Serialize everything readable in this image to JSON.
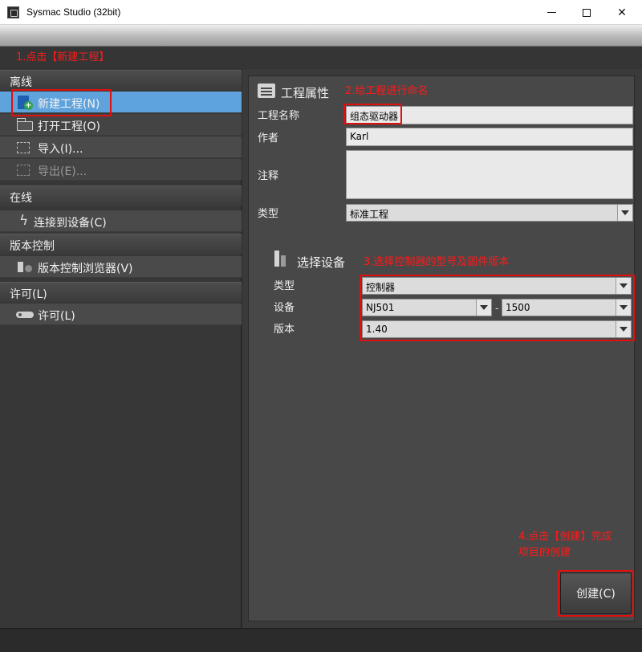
{
  "window": {
    "title": "Sysmac Studio (32bit)"
  },
  "annotations": {
    "step1": "1.点击【新建工程】",
    "step2": "2.给工程进行命名",
    "step3": "3.选择控制器的型号及固件版本",
    "step4_line1": "4.点击【创建】完成",
    "step4_line2": "项目的创建"
  },
  "sidebar": {
    "offline": {
      "header": "离线",
      "items": [
        {
          "label": "新建工程(N)",
          "icon": "new-project-icon"
        },
        {
          "label": "打开工程(O)",
          "icon": "folder-icon"
        },
        {
          "label": "导入(I)...",
          "icon": "import-icon"
        },
        {
          "label": "导出(E)...",
          "icon": "export-icon"
        }
      ]
    },
    "online": {
      "header": "在线",
      "items": [
        {
          "label": "连接到设备(C)",
          "icon": "lightning-icon"
        }
      ]
    },
    "version_control": {
      "header": "版本控制",
      "items": [
        {
          "label": "版本控制浏览器(V)",
          "icon": "version-control-icon"
        }
      ]
    },
    "license": {
      "header": "许可(L)",
      "items": [
        {
          "label": "许可(L)",
          "icon": "key-icon"
        }
      ]
    }
  },
  "project_properties": {
    "title": "工程属性",
    "name_label": "工程名称",
    "name_value": "组态驱动器",
    "author_label": "作者",
    "author_value": "Karl",
    "comment_label": "注释",
    "comment_value": "",
    "type_label": "类型",
    "type_value": "标准工程"
  },
  "device_selection": {
    "title": "选择设备",
    "category_label": "类型",
    "category_value": "控制器",
    "device_label": "设备",
    "device_model": "NJ501",
    "device_variant": "1500",
    "device_separator": "-",
    "version_label": "版本",
    "version_value": "1.40"
  },
  "actions": {
    "create_label": "创建(C)"
  },
  "colors": {
    "selected": "#5fa3dd",
    "annotation": "#ff1a1a",
    "panel": "#484848"
  }
}
